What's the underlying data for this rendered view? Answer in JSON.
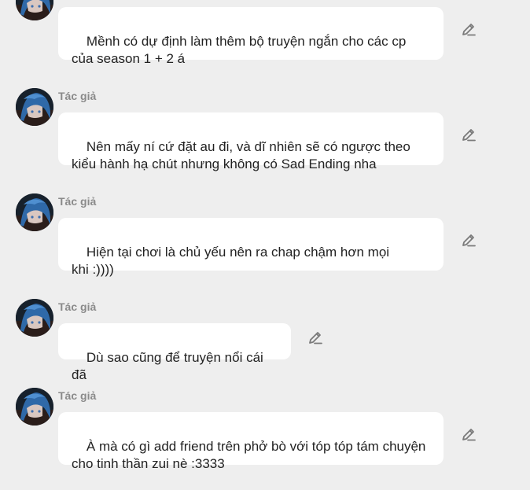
{
  "messages": [
    {
      "author": "",
      "text": "Mềnh có dự định làm thêm bộ truyện ngắn cho các cp\ncủa season 1 + 2 á",
      "avatar_icon": "character-avatar-icon",
      "edit_icon": "pencil-icon"
    },
    {
      "author": "Tác giả",
      "text": "Nên mấy ní cứ đặt au đi, và dĩ nhiên sẽ có ngược theo\nkiểu hành hạ chút nhưng không có Sad Ending nha",
      "avatar_icon": "character-avatar-icon",
      "edit_icon": "pencil-icon"
    },
    {
      "author": "Tác giả",
      "text": "Hiện tại chơi là chủ yếu nên ra chap chậm hơn mọi\nkhi :))))",
      "avatar_icon": "character-avatar-icon",
      "edit_icon": "pencil-icon"
    },
    {
      "author": "Tác giả",
      "text": "Dù sao cũng để truyện nổi cái đã",
      "avatar_icon": "character-avatar-icon",
      "edit_icon": "pencil-icon"
    },
    {
      "author": "Tác giả",
      "text": "À mà có gì add friend trên phở bò với tóp tóp tám chuyện\ncho tinh thần zui nè :3333",
      "avatar_icon": "character-avatar-icon",
      "edit_icon": "pencil-icon"
    }
  ],
  "colors": {
    "background": "#eeeeee",
    "bubble": "#ffffff",
    "author_text": "#8a8a8a",
    "message_text": "#222222",
    "icon": "#7a7a7a"
  }
}
